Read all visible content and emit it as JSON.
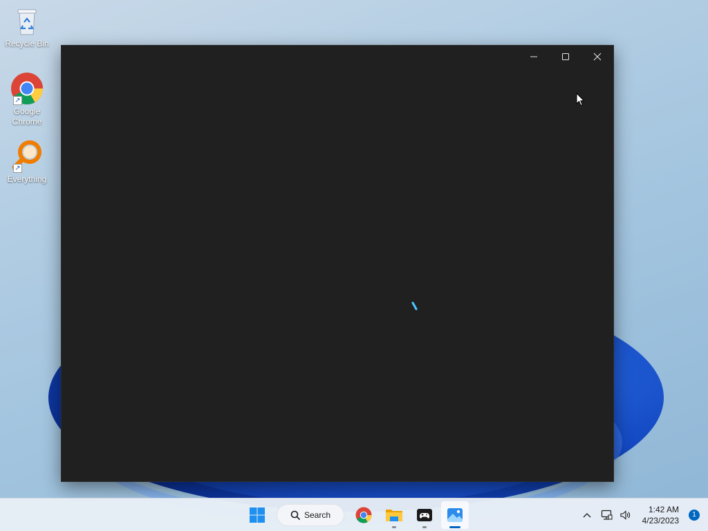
{
  "desktop": {
    "icons": [
      {
        "label": "Recycle Bin",
        "icon": "recycle-bin-icon"
      },
      {
        "label": "Google\nChrome",
        "icon": "chrome-icon",
        "shortcut": true
      },
      {
        "label": "Everything",
        "icon": "everything-search-icon",
        "shortcut": true
      }
    ]
  },
  "window": {
    "state": "loading",
    "background": "#202020",
    "controls": {
      "minimize_icon": "minimize-icon",
      "maximize_icon": "maximize-icon",
      "close_icon": "close-icon"
    },
    "spinner_color": "#4cc2ff"
  },
  "taskbar": {
    "start_icon": "windows-start-icon",
    "search_label": "Search",
    "apps": [
      {
        "name": "Google Chrome",
        "icon": "chrome-icon",
        "running": false
      },
      {
        "name": "File Explorer",
        "icon": "file-explorer-icon",
        "running": true
      },
      {
        "name": "Game controller app",
        "icon": "gamepad-icon",
        "running": true
      },
      {
        "name": "Photos",
        "icon": "photos-icon",
        "running": true,
        "active": true
      }
    ],
    "tray": {
      "overflow_icon": "chevron-up-icon",
      "network_icon": "network-icon",
      "volume_icon": "speaker-icon",
      "time": "1:42 AM",
      "date": "4/23/2023",
      "notification_count": "1"
    }
  },
  "colors": {
    "accent": "#0067c0",
    "taskbar": "#e8eef6",
    "wallpaper_blue": "#1348c2"
  }
}
